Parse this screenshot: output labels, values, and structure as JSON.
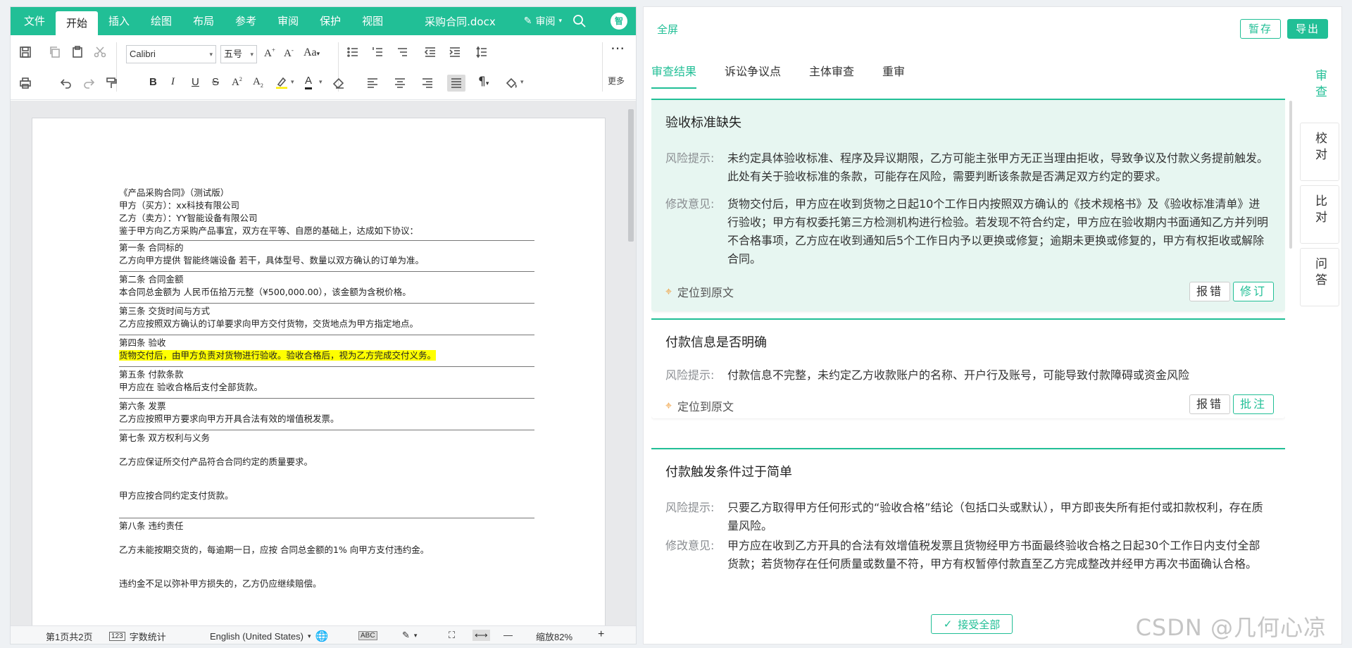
{
  "ribbon": {
    "tabs": [
      "文件",
      "开始",
      "插入",
      "绘图",
      "布局",
      "参考",
      "审阅",
      "保护",
      "视图"
    ],
    "active_tab": "开始",
    "doc_title": "采购合同.docx",
    "review_menu": "审阅",
    "avatar": "智"
  },
  "toolbar": {
    "font": "Calibri",
    "size": "五号",
    "grow": "A",
    "shrink": "A",
    "case": "Aa",
    "bold": "B",
    "italic": "I",
    "underline": "U",
    "strike": "S",
    "sub": "A",
    "font_color": "A",
    "more": "更多"
  },
  "document": {
    "lines": [
      {
        "text": "《产品采购合同》（测试版）"
      },
      {
        "text": "甲方（买方）：xx科技有限公司"
      },
      {
        "text": "乙方（卖方）：YY智能设备有限公司"
      },
      {
        "text": "鉴于甲方向乙方采购产品事宜，双方在平等、自愿的基础上，达成如下协议："
      },
      {
        "text": "第一条 合同标的"
      },
      {
        "text": "乙方向甲方提供 智能终端设备 若干，具体型号、数量以双方确认的订单为准。"
      },
      {
        "text": "第二条 合同金额"
      },
      {
        "text": "本合同总金额为 人民币伍拾万元整（¥500,000.00），该金额为含税价格。"
      },
      {
        "text": "第三条 交货时间与方式"
      },
      {
        "text": "乙方应按照双方确认的订单要求向甲方交付货物，交货地点为甲方指定地点。"
      },
      {
        "text": "第四条 验收"
      },
      {
        "text": "货物交付后，由甲方负责对货物进行验收。验收合格后，视为乙方完成交付义务。"
      },
      {
        "text": "第五条 付款条款"
      },
      {
        "text": "甲方应在 验收合格后支付全部货款。"
      },
      {
        "text": "第六条 发票"
      },
      {
        "text": "乙方应按照甲方要求向甲方开具合法有效的增值税发票。"
      },
      {
        "text": "第七条 双方权利与义务"
      },
      {
        "text": "乙方应保证所交付产品符合合同约定的质量要求。"
      },
      {
        "text": "甲方应按合同约定支付货款。"
      },
      {
        "text": "第八条 违约责任"
      },
      {
        "text": "乙方未能按期交货的，每逾期一日，应按 合同总金额的1% 向甲方支付违约金。"
      },
      {
        "text": "违约金不足以弥补甲方损失的，乙方仍应继续赔偿。"
      }
    ]
  },
  "statusbar": {
    "page": "第1页共2页",
    "wordcount": "字数统计",
    "language": "English (United States)",
    "zoom": "缩放82%",
    "minus": "—",
    "plus": "+"
  },
  "panel": {
    "fullscreen": "全屏",
    "save": "暂存",
    "export": "导出",
    "tabs": [
      "审查结果",
      "诉讼争议点",
      "主体审查",
      "重审"
    ],
    "active_tab": "审查结果",
    "side_tabs": [
      "审查",
      "校对",
      "比对",
      "问答"
    ],
    "accept_all": "接受全部",
    "locate_label": "定位到原文",
    "cards": [
      {
        "title": "验收标准缺失",
        "risk_label": "风险提示:",
        "risk": "未约定具体验收标准、程序及异议期限，乙方可能主张甲方无正当理由拒收，导致争议及付款义务提前触发。 此处有关于验收标准的条款，可能存在风险，需要判断该条款是否满足双方约定的要求。",
        "advice_label": "修改意见:",
        "advice": "货物交付后，甲方应在收到货物之日起10个工作日内按照双方确认的《技术规格书》及《验收标准清单》进行验收；甲方有权委托第三方检测机构进行检验。若发现不符合约定，甲方应在验收期内书面通知乙方并列明不合格事项，乙方应在收到通知后5个工作日内予以更换或修复；逾期未更换或修复的，甲方有权拒收或解除合同。",
        "btn_error": "报错",
        "btn_action": "修订"
      },
      {
        "title": "付款信息是否明确",
        "risk_label": "风险提示:",
        "risk": "付款信息不完整，未约定乙方收款账户的名称、开户行及账号，可能导致付款障碍或资金风险",
        "btn_error": "报错",
        "btn_action": "批注"
      },
      {
        "title": "付款触发条件过于简单",
        "risk_label": "风险提示:",
        "risk": "只要乙方取得甲方任何形式的“验收合格”结论（包括口头或默认），甲方即丧失所有拒付或扣款权利，存在质量风险。",
        "advice_label": "修改意见:",
        "advice": "甲方应在收到乙方开具的合法有效增值税发票且货物经甲方书面最终验收合格之日起30个工作日内支付全部货款；若货物存在任何质量或数量不符，甲方有权暂停付款直至乙方完成整改并经甲方再次书面确认合格。"
      }
    ]
  },
  "watermark": "CSDN @几何心凉",
  "colors": {
    "accent": "#21bf96",
    "highlight": "#ffff00",
    "selected_card": "#e7f6f1"
  }
}
